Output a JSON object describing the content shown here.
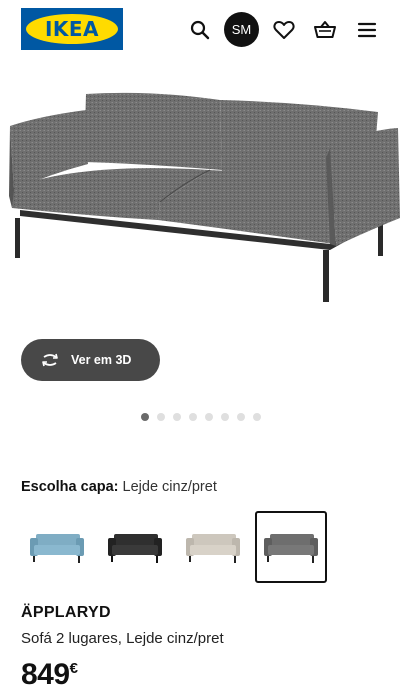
{
  "header": {
    "logo_text": "IKEA",
    "avatar_initials": "SM",
    "icons": [
      "search-icon",
      "heart-icon",
      "basket-icon",
      "menu-icon"
    ]
  },
  "gallery": {
    "view_3d_label": "Ver em 3D",
    "total_images": 8,
    "active_index": 0
  },
  "cover": {
    "label": "Escolha capa:",
    "selected_value": "Lejde cinz/pret",
    "options": [
      {
        "color": "#7fadc4",
        "selected": false
      },
      {
        "color": "#2f2f2f",
        "selected": false
      },
      {
        "color": "#cdc7bd",
        "selected": false
      },
      {
        "color": "#6e6e6e",
        "selected": true
      }
    ]
  },
  "product": {
    "name": "ÄPPLARYD",
    "description": "Sofá 2 lugares, Lejde cinz/pret",
    "price": "849",
    "currency": "€"
  },
  "colors": {
    "brand_blue": "#0058a3",
    "brand_yellow": "#ffdb00",
    "sofa_grey": "#6b6b6b"
  }
}
